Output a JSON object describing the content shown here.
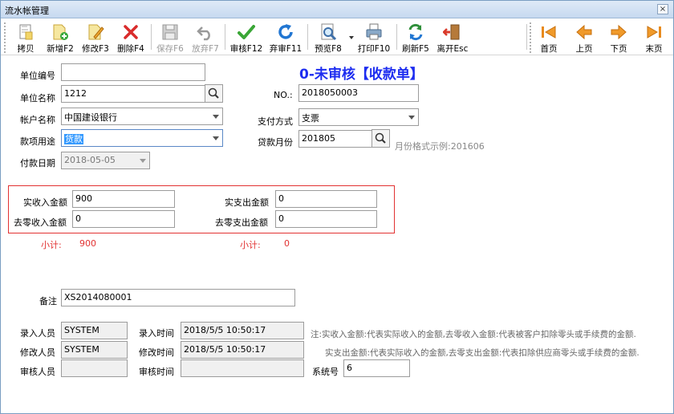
{
  "window": {
    "title": "流水帐管理",
    "close_label": "×"
  },
  "toolbar": {
    "copy": "拷贝",
    "add": "新增F2",
    "edit": "修改F3",
    "delete": "删除F4",
    "save": "保存F6",
    "abandon": "放弃F7",
    "audit": "审核F12",
    "unaudit": "弃审F11",
    "preview": "预览F8",
    "print": "打印F10",
    "refresh": "刷新F5",
    "exit": "离开Esc",
    "first": "首页",
    "prev": "上页",
    "next": "下页",
    "last": "末页"
  },
  "status_heading": "0-未审核【收款单】",
  "form": {
    "unit_code_label": "单位编号",
    "unit_code": "",
    "unit_name_label": "单位名称",
    "unit_name": "1212",
    "account_name_label": "帐户名称",
    "account_name": "中国建设银行",
    "purpose_label": "款项用途",
    "purpose": "货款",
    "pay_date_label": "付款日期",
    "pay_date": "2018-05-05",
    "no_label": "NO.:",
    "no": "2018050003",
    "pay_method_label": "支付方式",
    "pay_method": "支票",
    "loan_month_label": "贷款月份",
    "loan_month": "201805",
    "month_hint": "月份格式示例:201606"
  },
  "amounts": {
    "actual_income_label": "实收入金额",
    "actual_income": "900",
    "rounding_income_label": "去零收入金额",
    "rounding_income": "0",
    "actual_expense_label": "实支出金额",
    "actual_expense": "0",
    "rounding_expense_label": "去零支出金额",
    "rounding_expense": "0",
    "subtotal_label": "小计:",
    "subtotal_income": "900",
    "subtotal_expense": "0"
  },
  "remarks": {
    "label": "备注",
    "value": "XS2014080001"
  },
  "audit_info": {
    "entry_person_label": "录入人员",
    "entry_person": "SYSTEM",
    "entry_time_label": "录入时间",
    "entry_time": "2018/5/5 10:50:17",
    "modifier_label": "修改人员",
    "modifier": "SYSTEM",
    "modify_time_label": "修改时间",
    "modify_time": "2018/5/5 10:50:17",
    "auditor_label": "审核人员",
    "auditor": "",
    "audit_time_label": "审核时间",
    "audit_time": "",
    "system_no_label": "系统号",
    "system_no": "6"
  },
  "notes": {
    "line1": "注:实收入金额:代表实际收入的金额,去零收入金额:代表被客户扣除零头或手续费的金额.",
    "line2": "实支出金额:代表实际收入的金额,去零支出金额:代表扣除供应商零头或手续费的金额."
  },
  "colors": {
    "heading": "#1d2df0",
    "highlight_border": "#e23232",
    "subtotal": "#e23232"
  }
}
